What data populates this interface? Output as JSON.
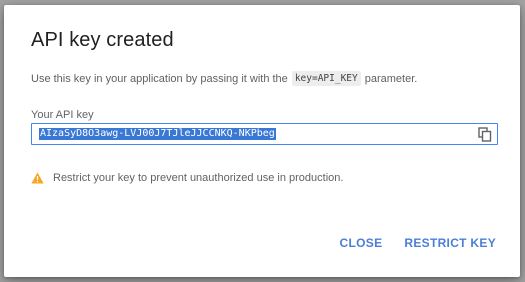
{
  "dialog": {
    "title": "API key created",
    "description_before": "Use this key in your application by passing it with the",
    "description_code": "key=API_KEY",
    "description_after": "parameter.",
    "field_label": "Your API key",
    "api_key": "AIzaSyD8O3awg-LVJ00J7TJleJJCCNKQ-NKPbeg",
    "warning_text": "Restrict your key to prevent unauthorized use in production.",
    "buttons": {
      "close": "CLOSE",
      "restrict": "RESTRICT KEY"
    }
  },
  "colors": {
    "accent": "#4a7fd6",
    "field_border": "#4285f4",
    "selection": "#3a78d6",
    "warning": "#f6a623"
  },
  "icons": {
    "copy": "copy-icon",
    "warning": "warning-icon"
  }
}
